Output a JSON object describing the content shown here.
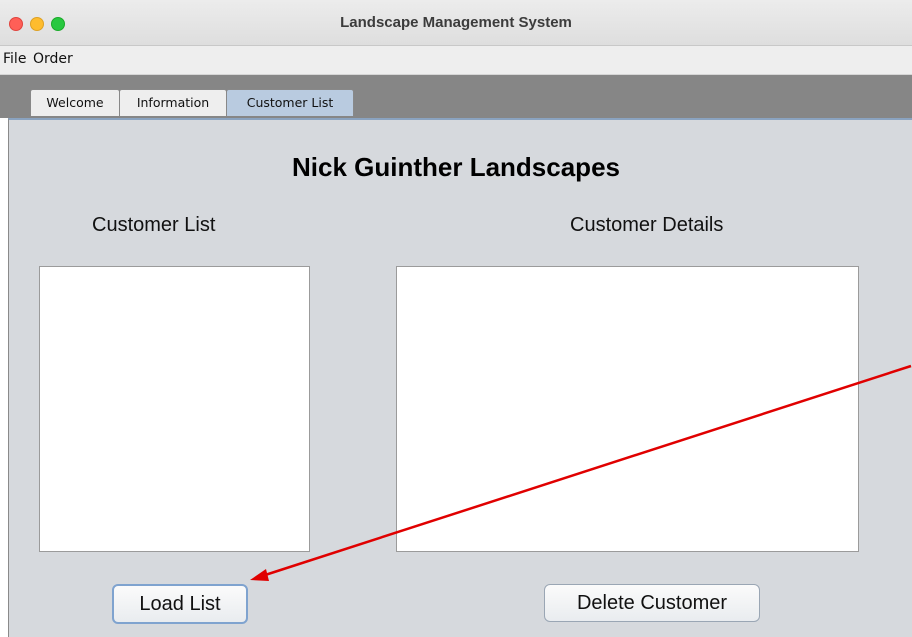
{
  "window": {
    "title": "Landscape Management System"
  },
  "menubar": {
    "items": [
      "File",
      "Order"
    ]
  },
  "tabs": [
    {
      "label": "Welcome",
      "active": false
    },
    {
      "label": "Information",
      "active": false
    },
    {
      "label": "Customer List",
      "active": true
    }
  ],
  "content": {
    "heading": "Nick Guinther Landscapes",
    "customer_list_label": "Customer List",
    "customer_details_label": "Customer Details",
    "load_button": "Load List",
    "delete_button": "Delete Customer"
  },
  "annotation": {
    "color": "#e00000"
  }
}
